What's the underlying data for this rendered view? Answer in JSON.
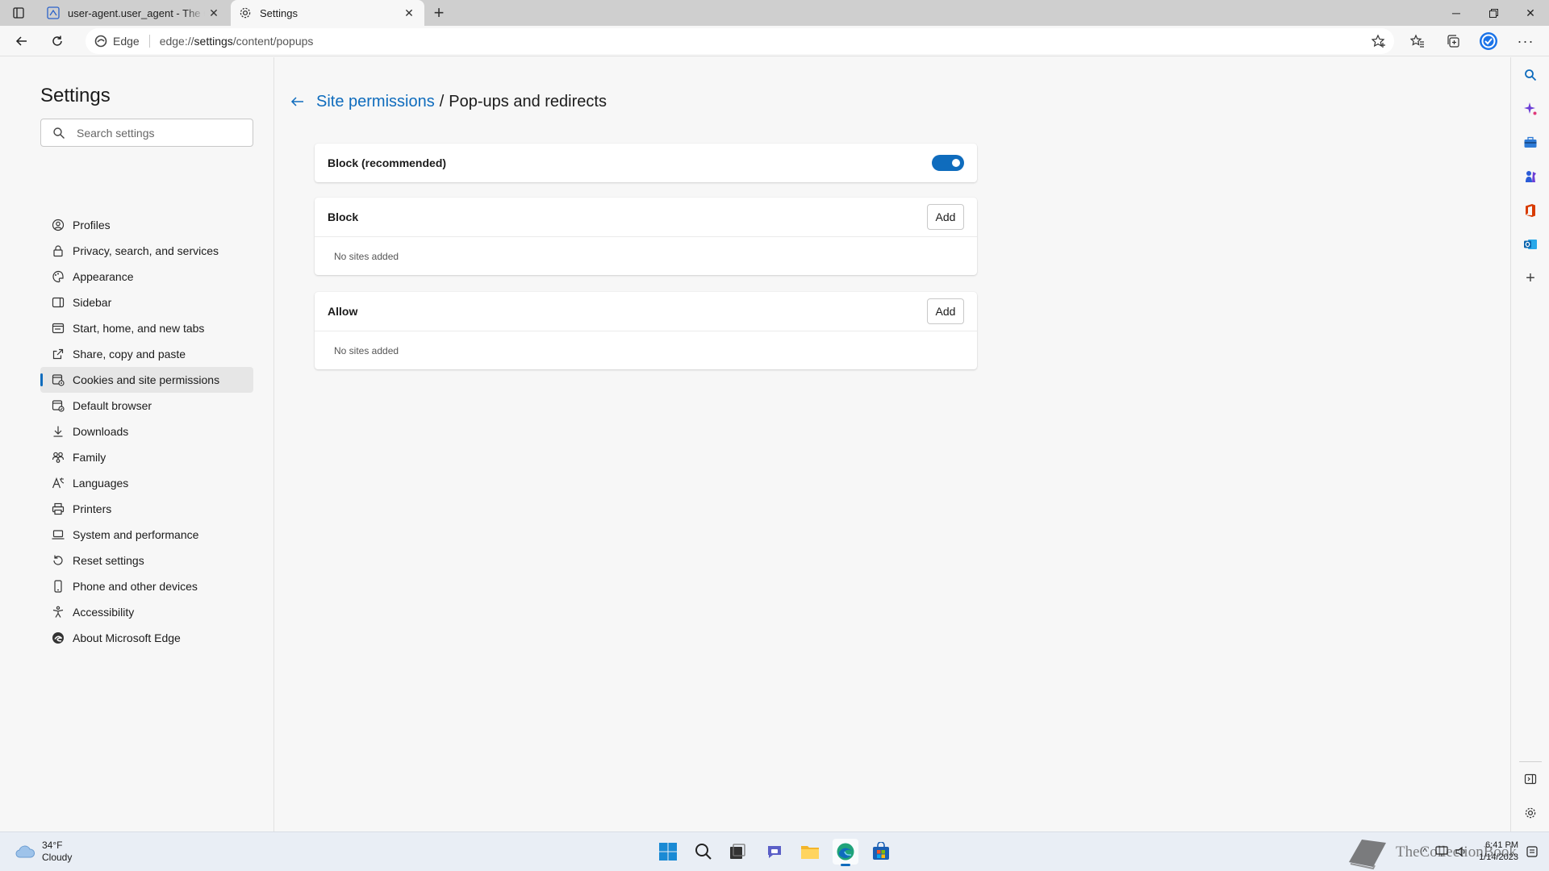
{
  "browser": {
    "tabs": [
      {
        "title": "user-agent.user_agent - The Coll",
        "active": false
      },
      {
        "title": "Settings",
        "active": true
      }
    ],
    "address": {
      "site_name": "Edge",
      "url_scheme": "edge://",
      "url_host": "settings",
      "url_path": "/content/popups"
    }
  },
  "settings_nav": {
    "title": "Settings",
    "search_placeholder": "Search settings",
    "items": [
      {
        "label": "Profiles",
        "icon": "profile-icon"
      },
      {
        "label": "Privacy, search, and services",
        "icon": "lock-icon"
      },
      {
        "label": "Appearance",
        "icon": "palette-icon"
      },
      {
        "label": "Sidebar",
        "icon": "sidebar-icon"
      },
      {
        "label": "Start, home, and new tabs",
        "icon": "home-tabs-icon"
      },
      {
        "label": "Share, copy and paste",
        "icon": "share-icon"
      },
      {
        "label": "Cookies and site permissions",
        "icon": "cookies-icon",
        "selected": true
      },
      {
        "label": "Default browser",
        "icon": "browser-icon"
      },
      {
        "label": "Downloads",
        "icon": "download-icon"
      },
      {
        "label": "Family",
        "icon": "family-icon"
      },
      {
        "label": "Languages",
        "icon": "languages-icon"
      },
      {
        "label": "Printers",
        "icon": "printer-icon"
      },
      {
        "label": "System and performance",
        "icon": "laptop-icon"
      },
      {
        "label": "Reset settings",
        "icon": "reset-icon"
      },
      {
        "label": "Phone and other devices",
        "icon": "phone-icon"
      },
      {
        "label": "Accessibility",
        "icon": "accessibility-icon"
      },
      {
        "label": "About Microsoft Edge",
        "icon": "edge-icon"
      }
    ]
  },
  "page": {
    "breadcrumb_parent": "Site permissions",
    "breadcrumb_separator": "/",
    "breadcrumb_current": "Pop-ups and redirects",
    "block_recommended": {
      "label": "Block (recommended)",
      "enabled": true
    },
    "block_section": {
      "label": "Block",
      "add_label": "Add",
      "empty_text": "No sites added"
    },
    "allow_section": {
      "label": "Allow",
      "add_label": "Add",
      "empty_text": "No sites added"
    }
  },
  "taskbar": {
    "weather_temp": "34°F",
    "weather_desc": "Cloudy",
    "time": "6:41 PM",
    "date": "1/14/2023",
    "watermark": "TheCollectionBook"
  },
  "colors": {
    "accent": "#0f6cbd",
    "page_bg": "#f7f7f7",
    "tabstrip_bg": "#cfcfcf"
  }
}
